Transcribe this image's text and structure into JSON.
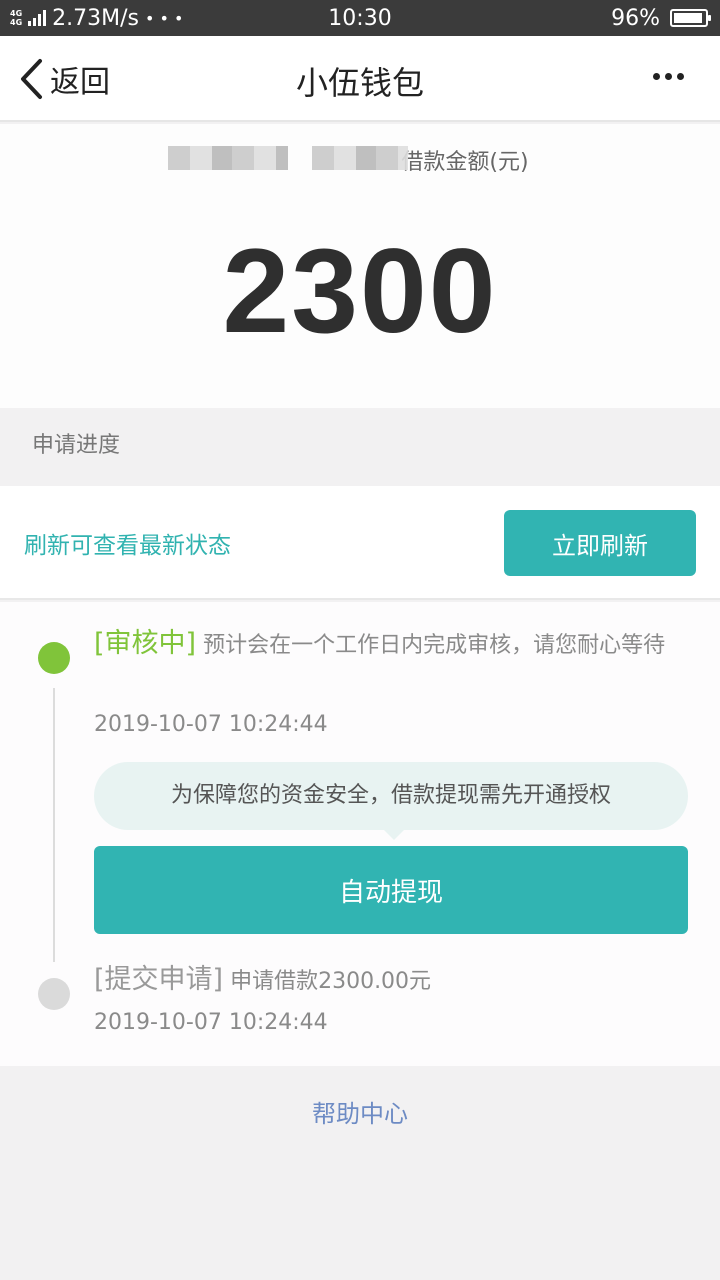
{
  "status_bar": {
    "network": "4G",
    "speed": "2.73M/s",
    "dots": "• • •",
    "time": "10:30",
    "battery": "96%"
  },
  "nav": {
    "back_label": "返回",
    "title": "小伍钱包"
  },
  "loan": {
    "amount_label": "借款金额(元)",
    "amount": "2300"
  },
  "progress": {
    "section_title": "申请进度",
    "refresh_hint": "刷新可查看最新状态",
    "refresh_button": "立即刷新",
    "steps": [
      {
        "tag": "[审核中]",
        "text": "预计会在一个工作日内完成审核，请您耐心等待",
        "time": "2019-10-07 10:24:44",
        "status": "active",
        "color": "#80c43a"
      },
      {
        "tag": "[提交申请]",
        "text": "申请借款2300.00元",
        "time": "2019-10-07 10:24:44",
        "status": "done",
        "color": "#dadada"
      }
    ],
    "tip": "为保障您的资金安全，借款提现需先开通授权",
    "auto_withdraw_button": "自动提现"
  },
  "footer": {
    "help_label": "帮助中心"
  },
  "colors": {
    "accent": "#31b4b2",
    "active": "#80c43a",
    "link": "#6d8bc4"
  }
}
